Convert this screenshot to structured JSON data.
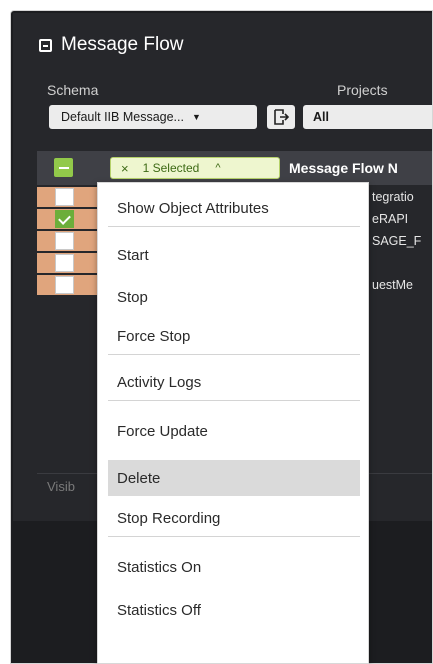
{
  "panel": {
    "title": "Message Flow"
  },
  "filters": {
    "schema_label": "Schema",
    "schema_value": "Default IIB Message...",
    "projects_label": "Projects",
    "projects_value": "All"
  },
  "table": {
    "selected_badge": "1 Selected",
    "column_header": "Message Flow N",
    "rows": [
      {
        "checked": false,
        "cell": "tegratio"
      },
      {
        "checked": true,
        "cell": "eRAPI"
      },
      {
        "checked": false,
        "cell": "SAGE_F"
      },
      {
        "checked": false,
        "cell": ""
      },
      {
        "checked": false,
        "cell": "uestMe"
      }
    ],
    "footer_label": "Visib"
  },
  "menu": {
    "items": [
      {
        "label": "Show Object Attributes",
        "separator": true
      },
      {
        "label": "Start",
        "separator": false
      },
      {
        "label": "Stop",
        "separator": false
      },
      {
        "label": "Force Stop",
        "separator": true
      },
      {
        "label": "Activity Logs",
        "separator": true
      },
      {
        "label": "Force Update",
        "separator": false
      },
      {
        "label": "Delete",
        "separator": false,
        "active": true
      },
      {
        "label": "Stop Recording",
        "separator": true
      },
      {
        "label": "Statistics On",
        "separator": false
      },
      {
        "label": "Statistics Off",
        "separator": false
      }
    ]
  },
  "icons": {
    "collapse": "collapse-square-icon",
    "export": "export-icon",
    "dropdown": "chevron-down-icon",
    "clear_selection": "close-icon",
    "collapse_menu": "chevron-up-icon"
  },
  "colors": {
    "panel_bg": "#26272b",
    "header_bg": "#3f4046",
    "accent_green": "#92c94a",
    "row_stripe": "#e0a57d",
    "menu_active": "#dadada"
  }
}
